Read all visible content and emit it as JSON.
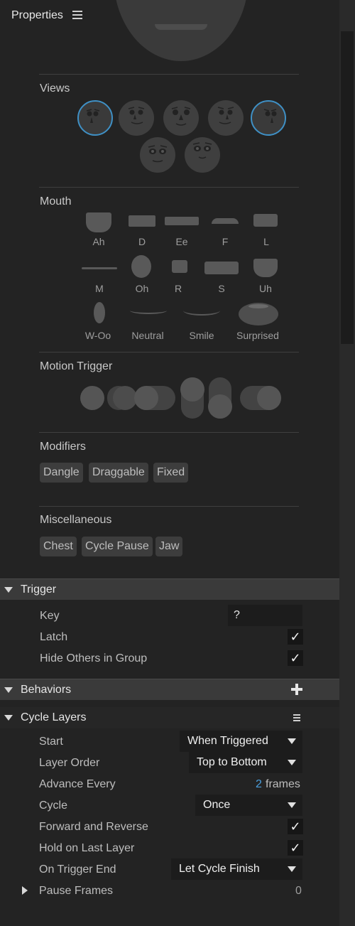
{
  "panel": {
    "title": "Properties",
    "menu_icon": "hamburger-icon"
  },
  "sections": {
    "views": {
      "label": "Views",
      "count": 7,
      "selected": [
        0,
        4
      ]
    },
    "mouth": {
      "label": "Mouth",
      "shapes": [
        "Ah",
        "D",
        "Ee",
        "F",
        "L",
        "M",
        "Oh",
        "R",
        "S",
        "Uh",
        "W-Oo",
        "Neutral",
        "Smile",
        "Surprised"
      ]
    },
    "motion_trigger": {
      "label": "Motion Trigger"
    },
    "modifiers": {
      "label": "Modifiers",
      "tags": [
        "Dangle",
        "Draggable",
        "Fixed"
      ]
    },
    "miscellaneous": {
      "label": "Miscellaneous",
      "tags": [
        "Chest",
        "Cycle Pause",
        "Jaw"
      ]
    }
  },
  "trigger": {
    "title": "Trigger",
    "key_label": "Key",
    "key_value": "?",
    "latch_label": "Latch",
    "latch_checked": true,
    "hide_label": "Hide Others in Group",
    "hide_checked": true,
    "check_glyph": "✓"
  },
  "behaviors": {
    "title": "Behaviors",
    "add_icon": "plus-icon"
  },
  "cycle_layers": {
    "title": "Cycle Layers",
    "start_label": "Start",
    "start_value": "When Triggered",
    "order_label": "Layer Order",
    "order_value": "Top to Bottom",
    "advance_label": "Advance Every",
    "advance_value": "2",
    "advance_unit": "frames",
    "cycle_label": "Cycle",
    "cycle_value": "Once",
    "fr_label": "Forward and Reverse",
    "fr_checked": true,
    "hold_label": "Hold on Last Layer",
    "hold_checked": true,
    "end_label": "On Trigger End",
    "end_value": "Let Cycle Finish",
    "pause_label": "Pause Frames",
    "pause_value": "0"
  },
  "colors": {
    "selection": "#3f90c5",
    "link_value": "#4a9fde"
  }
}
